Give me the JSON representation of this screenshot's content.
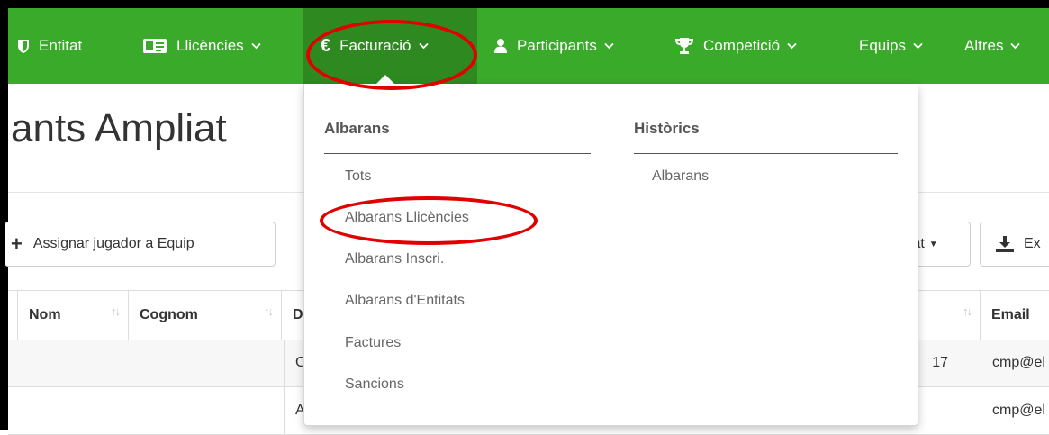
{
  "navbar": {
    "items": [
      {
        "label": "Entitat",
        "icon": "shield-icon"
      },
      {
        "label": "Llicències",
        "icon": "id-card-icon"
      },
      {
        "label": "Facturació",
        "icon": "euro-icon"
      },
      {
        "label": "Participants",
        "icon": "user-icon"
      },
      {
        "label": "Competició",
        "icon": "trophy-icon"
      },
      {
        "label": "Equips",
        "icon": ""
      },
      {
        "label": "Altres",
        "icon": ""
      }
    ],
    "active_item": "Facturació",
    "bg_color": "#3aaa2a",
    "active_bg_color": "#2e8a20"
  },
  "page": {
    "title": "ants Ampliat"
  },
  "toolbar": {
    "assign_label": "Assignar jugador a Equip",
    "partial_dropdown_label": "tat",
    "export_label": "Ex"
  },
  "table": {
    "columns": [
      "Nom",
      "Cognom",
      "D",
      "Email"
    ],
    "rows": [
      {
        "col3": "C",
        "num": "17",
        "email": "cmp@el"
      },
      {
        "col3": "A",
        "num": "",
        "email": "cmp@el"
      }
    ]
  },
  "dropdown": {
    "left_heading": "Albarans",
    "left_items": [
      "Tots",
      "Albarans Llicències",
      "Albarans Inscri.",
      "Albarans d'Entitats",
      "Factures",
      "Sancions"
    ],
    "right_heading": "Històrics",
    "right_items": [
      "Albarans"
    ]
  },
  "annotations": {
    "color": "#e00000",
    "highlighted": [
      "Facturació",
      "Albarans Llicències"
    ]
  }
}
